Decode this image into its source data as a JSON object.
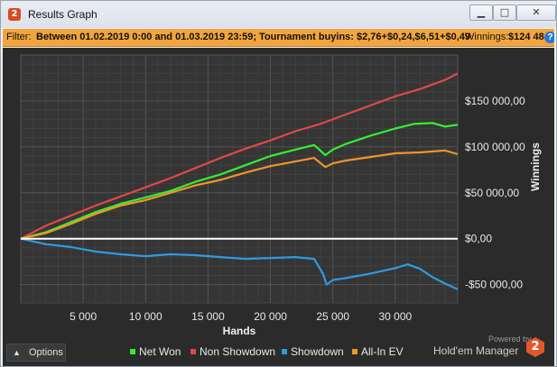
{
  "window": {
    "title": "Results Graph",
    "app_icon": "2",
    "controls": [
      "minimize-icon",
      "maximize-icon",
      "close-icon"
    ]
  },
  "filter": {
    "label": "Filter:",
    "value": "Between 01.02.2019 0:00 and 01.03.2019 23:59; Tournament buyins: $2,76+$0,24,$6,51+$0,49",
    "winnings_label": "Winnings:",
    "winnings_value": "$124 48"
  },
  "options": {
    "label": "Options"
  },
  "legend": [
    {
      "name": "Net Won",
      "color": "#33ee33"
    },
    {
      "name": "Non Showdown",
      "color": "#e04848"
    },
    {
      "name": "Showdown",
      "color": "#2f9ae0"
    },
    {
      "name": "All-In EV",
      "color": "#f0952a"
    }
  ],
  "branding": {
    "powered_by": "Powered by",
    "product": "Hold'em Manager",
    "logo": "2"
  },
  "chart_data": {
    "type": "line",
    "xlabel": "Hands",
    "ylabel": "Winnings",
    "xlim": [
      0,
      35000
    ],
    "ylim": [
      -70000,
      200000
    ],
    "x_ticks": [
      5000,
      10000,
      15000,
      20000,
      25000,
      30000
    ],
    "x_tick_labels": [
      "5 000",
      "10 000",
      "15 000",
      "20 000",
      "25 000",
      "30 000"
    ],
    "y_ticks": [
      150000,
      100000,
      50000,
      0,
      -50000
    ],
    "y_tick_labels": [
      "$150 000,00",
      "$100 000,00",
      "$50 000,00",
      "$0,00",
      "-$50 000,00"
    ],
    "grid": true,
    "zero_line": true,
    "legend_position": "bottom",
    "series": [
      {
        "name": "Non Showdown",
        "color": "#e04848",
        "x": [
          0,
          2000,
          4000,
          6000,
          8000,
          10000,
          12000,
          14000,
          16000,
          18000,
          20000,
          22000,
          24000,
          26000,
          28000,
          30000,
          32000,
          34000,
          35000
        ],
        "y": [
          0,
          14000,
          25000,
          36000,
          46000,
          56000,
          66000,
          77000,
          88000,
          98000,
          107000,
          117000,
          125000,
          135000,
          145000,
          155000,
          163000,
          173000,
          180000
        ]
      },
      {
        "name": "Net Won",
        "color": "#33ee33",
        "x": [
          0,
          2000,
          4000,
          6000,
          8000,
          10000,
          12000,
          14000,
          16000,
          18000,
          20000,
          22000,
          23500,
          24400,
          25000,
          26000,
          28000,
          30000,
          31500,
          33000,
          34000,
          35000
        ],
        "y": [
          0,
          7000,
          18000,
          29000,
          38000,
          45000,
          52000,
          62000,
          70000,
          80000,
          90000,
          97000,
          102000,
          91000,
          97000,
          103000,
          112000,
          120000,
          125000,
          126000,
          122000,
          124000
        ]
      },
      {
        "name": "All-In EV",
        "color": "#f0952a",
        "x": [
          0,
          2000,
          4000,
          6000,
          8000,
          10000,
          12000,
          14000,
          16000,
          18000,
          20000,
          22000,
          23500,
          24400,
          25000,
          26000,
          28000,
          30000,
          32000,
          34000,
          35000
        ],
        "y": [
          0,
          6000,
          16000,
          27000,
          36000,
          42000,
          50000,
          58000,
          64000,
          72000,
          79000,
          84000,
          88000,
          78000,
          82000,
          85000,
          89000,
          93000,
          94000,
          96000,
          92000
        ]
      },
      {
        "name": "Showdown",
        "color": "#2f9ae0",
        "x": [
          0,
          2000,
          4000,
          6000,
          8000,
          10000,
          12000,
          14000,
          16000,
          18000,
          20000,
          22000,
          23500,
          24200,
          24500,
          25000,
          26000,
          28000,
          30000,
          31000,
          32000,
          33000,
          34000,
          35000
        ],
        "y": [
          0,
          -6000,
          -9000,
          -14000,
          -17000,
          -19000,
          -17000,
          -18000,
          -20000,
          -22000,
          -21000,
          -20000,
          -22000,
          -38000,
          -50000,
          -45000,
          -43000,
          -38000,
          -32000,
          -28000,
          -33000,
          -42000,
          -49000,
          -55000
        ]
      }
    ]
  }
}
